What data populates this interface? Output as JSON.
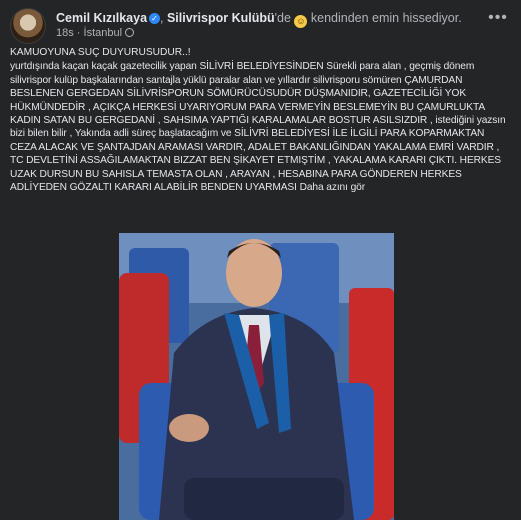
{
  "post": {
    "author": "Cemil Kızılkaya",
    "connector": ", ",
    "with_page": "Silivrispor Kulübü",
    "with_suffix": "'de ",
    "feeling": "kendinden emin hissediyor.",
    "time": "18s",
    "location": "İstanbul",
    "more": "•••",
    "text": [
      "KAMUOYUNA SUÇ DUYURUSUDUR..!",
      "yurtdışında kaçan kaçak gazetecilik yapan SİLİVRİ BELEDİYESİNDEN Sürekli para alan , geçmiş dönem silivrispor kulüp başkalarından santajla  yüklü paralar alan  ve yıllardır silivrisporu sömüren ÇAMURDAN BESLENEN GERGEDAN SİLİVRİSPORUN SÖMÜRÜCÜSUDÜR DÜŞMANIDIR, GAZETECİLİĞİ YOK HÜKMÜNDEDİR , AÇIKÇA HERKESİ UYARIYORUM PARA VERMEYİN BESLEMEYİN BU ÇAMURLUKTA KADIN SATAN BU  GERGEDANİ , SAHSIMA YAPTIĞI KARALAMALAR BOSTUR ASILSIZDIR , istediğini yazsın bizi bilen bilir , Yakında adli süreç başlatacağım ve SİLİVRİ BELEDİYESİ İLE İLGİLİ PARA KOPARMAKTAN CEZA ALACAK VE ŞANTAJDAN ARAMASI  VARDIR, ADALET BAKANLIĞINDAN YAKALAMA EMRİ VARDIR , TC DEVLETİNİ ASSAĞILAMAKTAN BIZZAT BEN ŞİKAYET ETMIŞTİM , YAKALAMA KARARI ÇIKTI. HERKES UZAK DURSUN BU SAHISLA TEMASTA OLAN , ARAYAN , HESABINA PARA GÖNDEREN HERKES ADLİYEDEN GÖZALTI KARARI ALABİLİR BENDEN UYARMASI Daha azını gör"
    ]
  },
  "colors": {
    "card_bg": "#242526",
    "text": "#e4e6eb",
    "secondary_text": "#b0b3b8",
    "verified": "#2d88ff"
  },
  "icons": {
    "verified": "verified-badge-icon",
    "feeling": "smile-emoji-icon",
    "privacy": "globe-icon",
    "more": "more-options-icon"
  }
}
